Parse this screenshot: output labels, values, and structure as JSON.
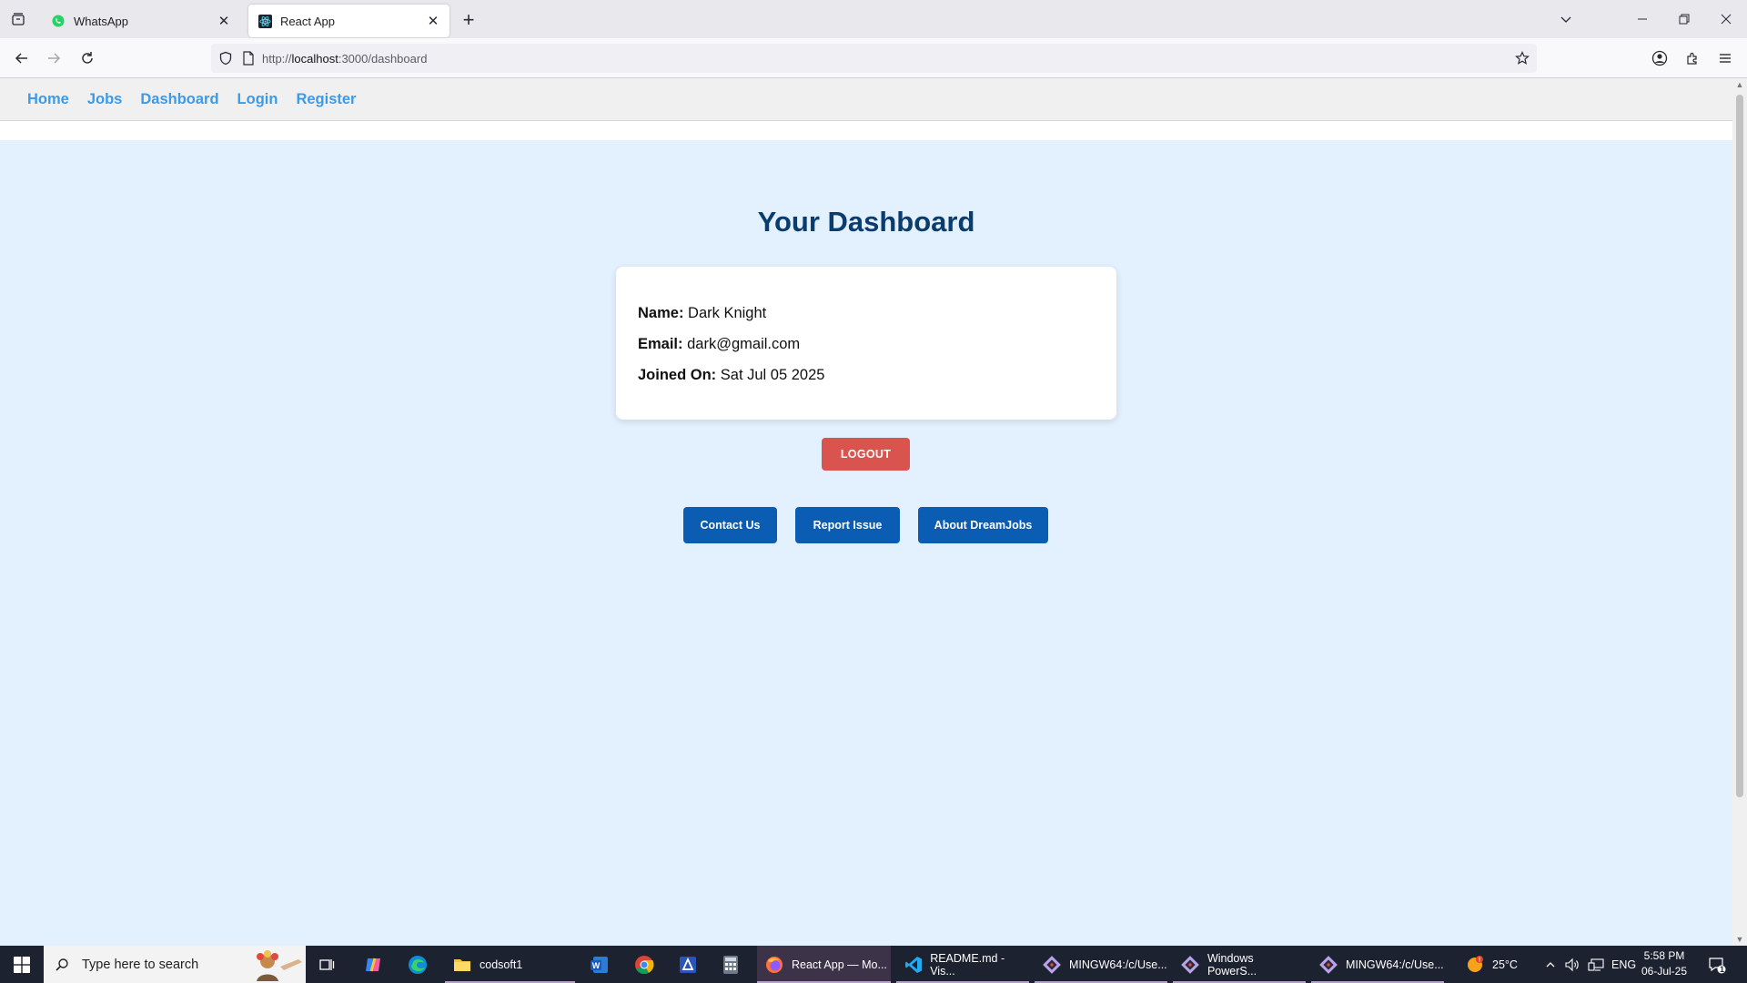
{
  "browser": {
    "tabs": [
      {
        "title": "WhatsApp",
        "active": false
      },
      {
        "title": "React App",
        "active": true
      }
    ],
    "url_scheme": "http://",
    "url_host": "localhost",
    "url_path": ":3000/dashboard"
  },
  "nav": {
    "links": [
      "Home",
      "Jobs",
      "Dashboard",
      "Login",
      "Register"
    ]
  },
  "dashboard": {
    "title": "Your Dashboard",
    "name_label": "Name:",
    "name_value": "Dark Knight",
    "email_label": "Email:",
    "email_value": "dark@gmail.com",
    "joined_label": "Joined On:",
    "joined_value": "Sat Jul 05 2025",
    "logout_label": "LOGOUT",
    "buttons": [
      "Contact Us",
      "Report Issue",
      "About DreamJobs"
    ]
  },
  "taskbar": {
    "search_placeholder": "Type here to search",
    "apps": [
      {
        "label": "codsoft1",
        "icon": "folder-icon"
      },
      {
        "label": "React App — Mo...",
        "icon": "firefox-icon"
      },
      {
        "label": "README.md - Vis...",
        "icon": "vscode-icon"
      },
      {
        "label": "MINGW64:/c/Use...",
        "icon": "git-bash-icon"
      },
      {
        "label": "Windows PowerS...",
        "icon": "git-bash-icon"
      },
      {
        "label": "MINGW64:/c/Use...",
        "icon": "git-bash-icon"
      }
    ],
    "weather": "25°C",
    "language": "ENG",
    "time": "5:58 PM",
    "date": "06-Jul-25",
    "notification_count": "1"
  },
  "colors": {
    "link": "#3b9bea",
    "title": "#0a3d6e",
    "logout": "#d9534f",
    "primary_button": "#0b5cb3",
    "page_bg": "#e3f0fd"
  }
}
